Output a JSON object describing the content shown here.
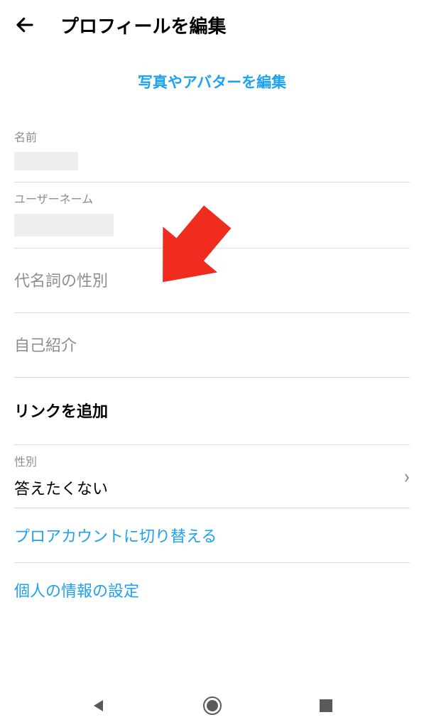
{
  "header": {
    "title": "プロフィールを編集"
  },
  "avatar_link": "写真やアバターを編集",
  "fields": {
    "name_label": "名前",
    "username_label": "ユーザーネーム",
    "pronoun_placeholder": "代名詞の性別",
    "bio_placeholder": "自己紹介",
    "add_link": "リンクを追加",
    "gender_label": "性別",
    "gender_value": "答えたくない"
  },
  "actions": {
    "switch_pro": "プロアカウントに切り替える",
    "personal_settings": "個人の情報の設定"
  },
  "colors": {
    "accent": "#1fa1f1",
    "arrow": "#f02c1f"
  }
}
